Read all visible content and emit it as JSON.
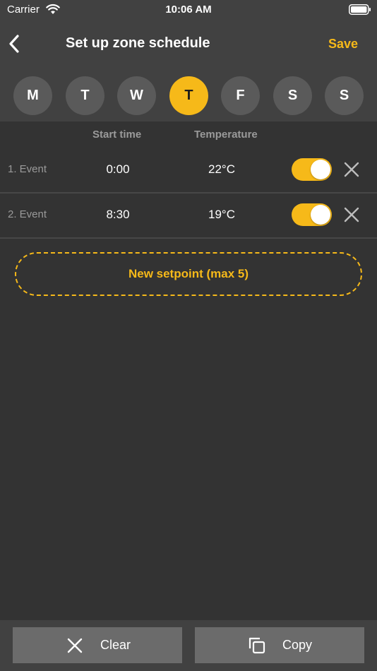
{
  "status_bar": {
    "carrier": "Carrier",
    "time": "10:06 AM",
    "wifi_icon": "wifi-icon",
    "battery_icon": "battery-icon"
  },
  "nav": {
    "back_icon": "chevron-left-icon",
    "title": "Set up zone schedule",
    "save_label": "Save"
  },
  "days": [
    {
      "label": "M",
      "selected": false
    },
    {
      "label": "T",
      "selected": false
    },
    {
      "label": "W",
      "selected": false
    },
    {
      "label": "T",
      "selected": true
    },
    {
      "label": "F",
      "selected": false
    },
    {
      "label": "S",
      "selected": false
    },
    {
      "label": "S",
      "selected": false
    }
  ],
  "columns": {
    "start_time": "Start time",
    "temperature": "Temperature"
  },
  "events": [
    {
      "label": "1. Event",
      "start_time": "0:00",
      "temperature": "22°C",
      "enabled": true
    },
    {
      "label": "2. Event",
      "start_time": "8:30",
      "temperature": "19°C",
      "enabled": true
    }
  ],
  "new_setpoint_label": "New setpoint (max 5)",
  "bottom": {
    "clear_label": "Clear",
    "clear_icon": "close-icon",
    "copy_label": "Copy",
    "copy_icon": "copy-icon"
  },
  "colors": {
    "accent": "#f6b919",
    "background": "#333333",
    "header_background": "#414141",
    "day_inactive": "#5a5a5a",
    "button_background": "#6b6b6b"
  }
}
